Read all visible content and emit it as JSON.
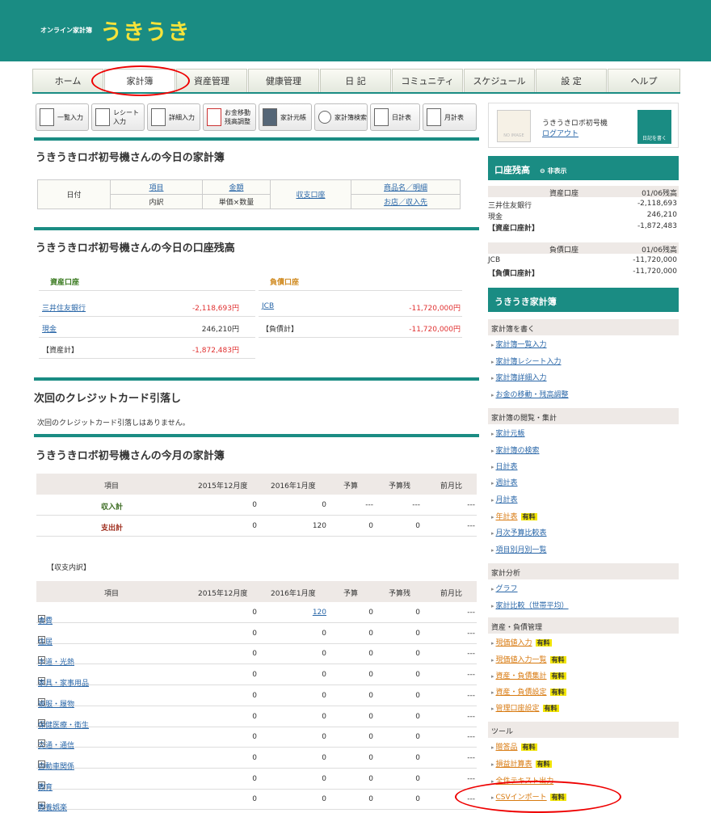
{
  "header": {
    "tagline": "オンライン家計簿",
    "logo": "うきうき"
  },
  "tabs": [
    "ホーム",
    "家計簿",
    "資産管理",
    "健康管理",
    "日 記",
    "コミュニティ",
    "スケジュール",
    "設 定",
    "ヘルプ"
  ],
  "toolbar": [
    "一覧入力",
    "レシート入力",
    "詳細入力",
    "お金移動残高調整",
    "家計元帳",
    "家計簿検索",
    "日計表",
    "月計表"
  ],
  "today": {
    "title": "うきうきロボ初号機さんの今日の家計簿",
    "h_date": "日付",
    "h_item": "項目",
    "h_breakdown": "内訳",
    "h_amount": "金額",
    "h_unit": "単価×数量",
    "h_account": "収支口座",
    "h_product": "商品名／明細",
    "h_store": "お店／収入先"
  },
  "balance": {
    "title": "うきうきロボ初号機さんの今日の口座残高",
    "asset_h": "資産口座",
    "liab_h": "負債口座",
    "a1": "三井住友銀行",
    "a1v": "-2,118,693円",
    "a2": "現金",
    "a2v": "246,210円",
    "a3": "【資産計】",
    "a3v": "-1,872,483円",
    "l1": "JCB",
    "l1v": "-11,720,000円",
    "l2": "【負債計】",
    "l2v": "-11,720,000円"
  },
  "credit": {
    "title": "次回のクレジットカード引落し",
    "msg": "次回のクレジットカード引落しはありません。"
  },
  "month": {
    "title": "うきうきロボ初号機さんの今月の家計簿",
    "cols": [
      "項目",
      "2015年12月度",
      "2016年1月度",
      "予算",
      "予算残",
      "前月比"
    ],
    "r1": [
      "収入計",
      "0",
      "0",
      "---",
      "---",
      "---"
    ],
    "r2": [
      "支出計",
      "0",
      "120",
      "0",
      "0",
      "---"
    ],
    "sub": "【収支内訳】",
    "rows": [
      [
        "食費",
        "0",
        "120",
        "0",
        "0",
        "---"
      ],
      [
        "住居",
        "0",
        "0",
        "0",
        "0",
        "---"
      ],
      [
        "水道・光熱",
        "0",
        "0",
        "0",
        "0",
        "---"
      ],
      [
        "家具・家事用品",
        "0",
        "0",
        "0",
        "0",
        "---"
      ],
      [
        "被服・履物",
        "0",
        "0",
        "0",
        "0",
        "---"
      ],
      [
        "保健医療・衛生",
        "0",
        "0",
        "0",
        "0",
        "---"
      ],
      [
        "交通・通信",
        "0",
        "0",
        "0",
        "0",
        "---"
      ],
      [
        "自動車関係",
        "0",
        "0",
        "0",
        "0",
        "---"
      ],
      [
        "教育",
        "0",
        "0",
        "0",
        "0",
        "---"
      ],
      [
        "教養娯楽",
        "0",
        "0",
        "0",
        "0",
        "---"
      ]
    ]
  },
  "user": {
    "name": "うきうきロボ初号機",
    "logout": "ログアウト",
    "noimage": "NO IMAGE",
    "diary": "日記を書く"
  },
  "side_bal": {
    "title": "口座残高",
    "hide": "非表示",
    "asset_h": "資産口座",
    "date": "01/06残高",
    "a1": "三井住友銀行",
    "a1v": "-2,118,693",
    "a2": "現金",
    "a2v": "246,210",
    "a3": "【資産口座計】",
    "a3v": "-1,872,483",
    "liab_h": "負債口座",
    "l1": "JCB",
    "l1v": "-11,720,000",
    "l2": "【負債口座計】",
    "l2v": "-11,720,000"
  },
  "menu": {
    "title": "うきうき家計簿",
    "paid": "有料",
    "c1": "家計簿を書く",
    "c1i": [
      "家計簿一覧入力",
      "家計簿レシート入力",
      "家計簿詳細入力",
      "お金の移動・残高調整"
    ],
    "c2": "家計簿の閲覧・集計",
    "c2i": [
      "家計元帳",
      "家計簿の検索",
      "日計表",
      "週計表",
      "月計表",
      "年計表",
      "月次予算比較表",
      "項目別月別一覧"
    ],
    "c3": "家計分析",
    "c3i": [
      "グラフ",
      "家計比較（世帯平均）"
    ],
    "c4": "資産・負債管理",
    "c4i": [
      "現価値入力",
      "現価値入力一覧",
      "資産・負債集計",
      "資産・負債設定",
      "管理口座設定"
    ],
    "c5": "ツール",
    "c5i": [
      "贈答品",
      "損益計算表",
      "全件テキスト出力",
      "CSVインポート"
    ]
  }
}
